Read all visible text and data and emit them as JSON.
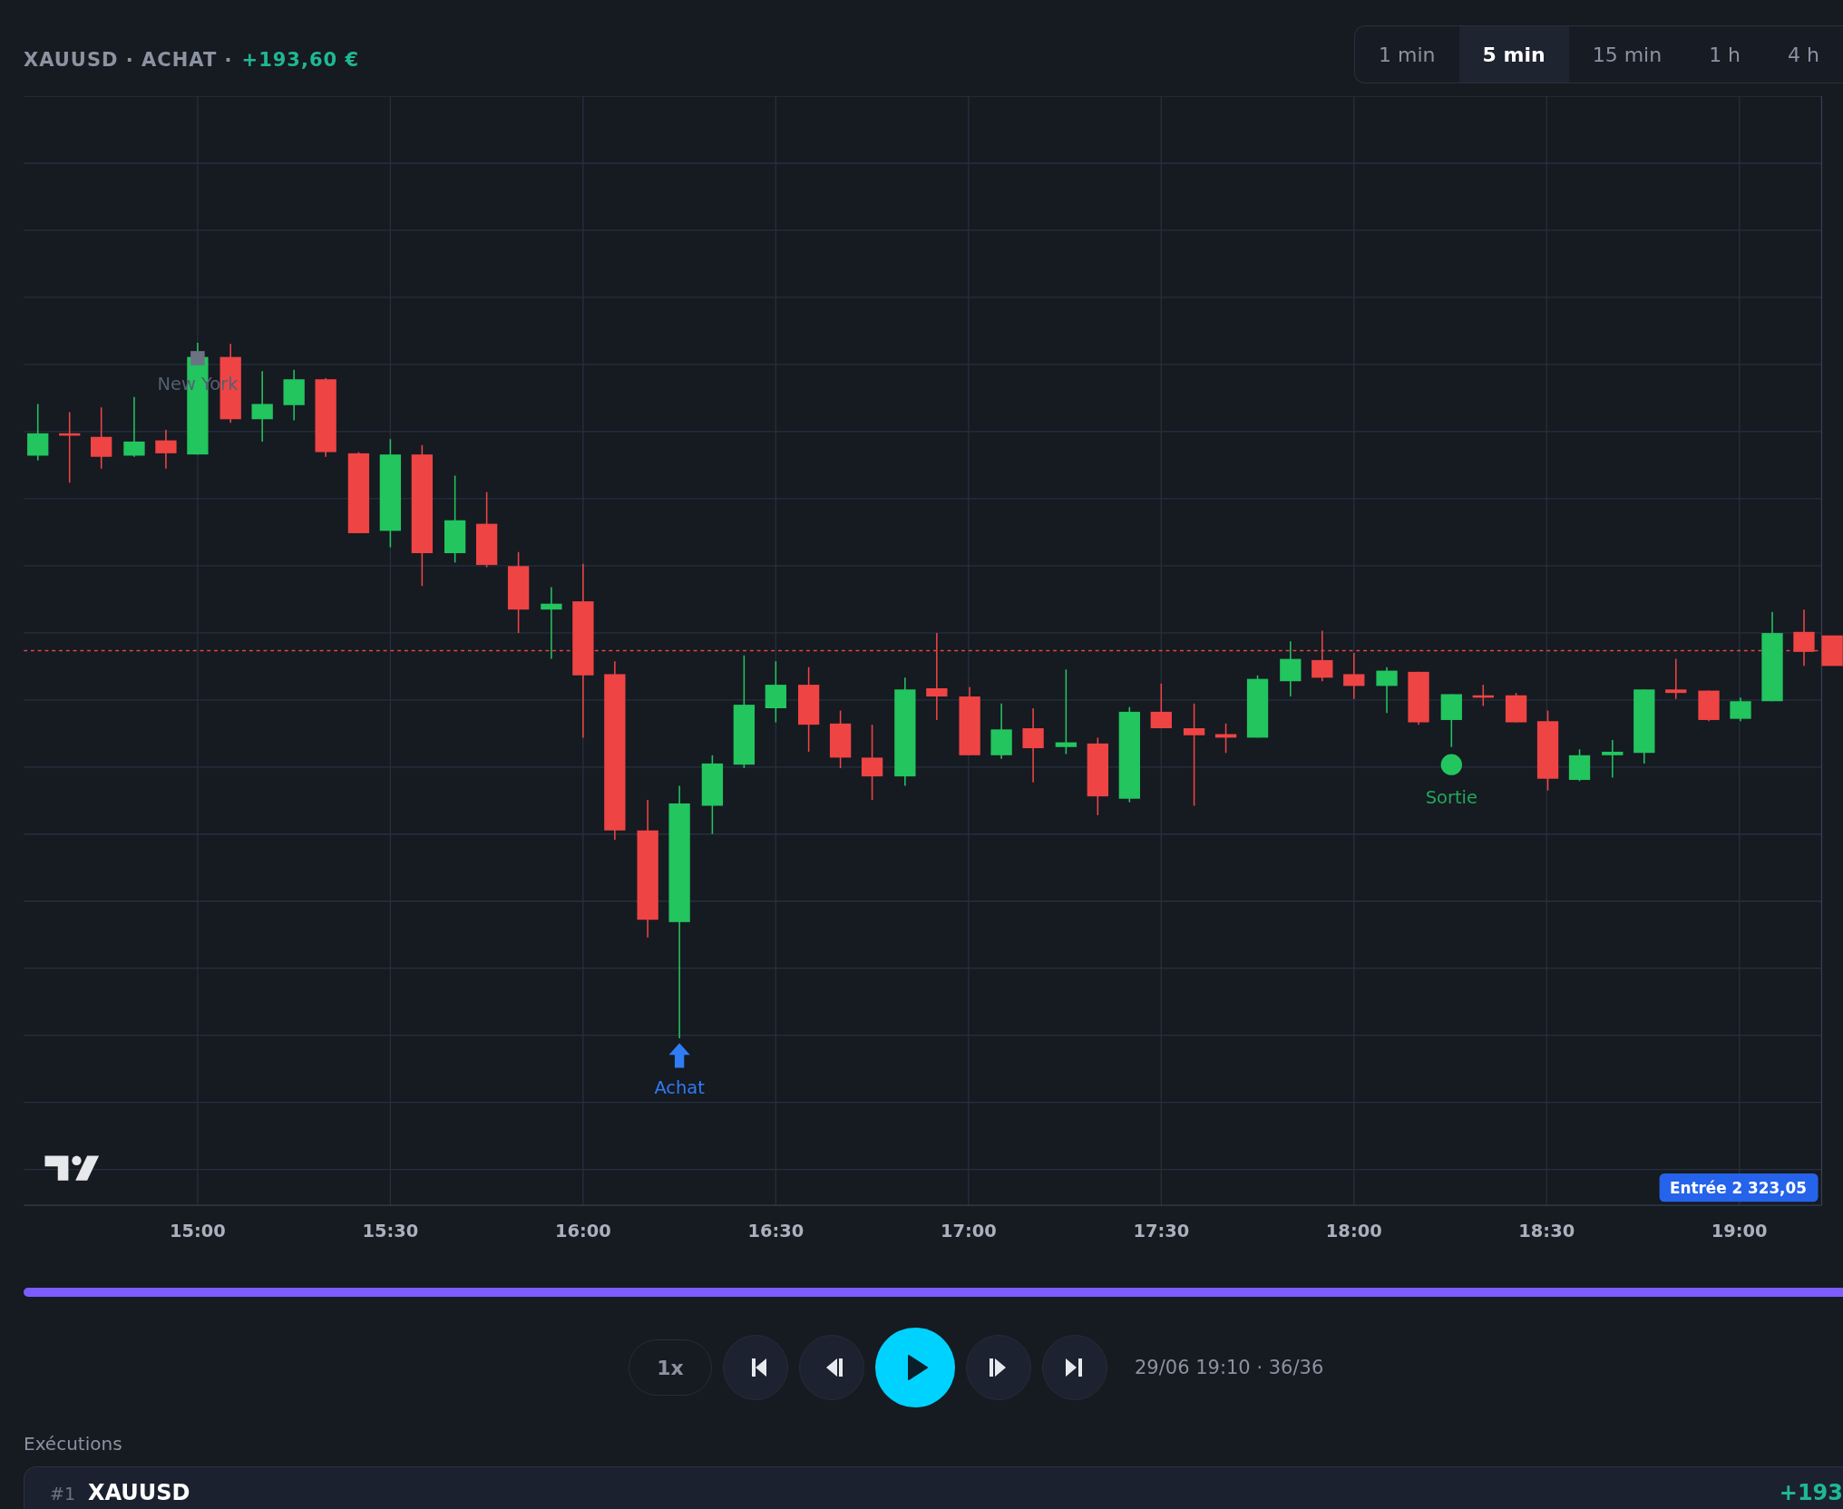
{
  "header": {
    "title": "XAUUSD · ACHAT ·",
    "pnl": "+193,60 €"
  },
  "timeframes": [
    {
      "label": "1 min",
      "selected": false
    },
    {
      "label": "5 min",
      "selected": true
    },
    {
      "label": "15 min",
      "selected": false
    },
    {
      "label": "1 h",
      "selected": false
    },
    {
      "label": "4 h",
      "selected": false
    }
  ],
  "chart": {
    "time_labels": [
      "15:00",
      "15:30",
      "16:00",
      "16:30",
      "17:00",
      "17:30",
      "18:00",
      "18:30",
      "19:00"
    ],
    "markers": [
      {
        "kind": "session",
        "label": "New York"
      },
      {
        "kind": "buy",
        "label": "Achat"
      },
      {
        "kind": "exit",
        "label": "Sortie"
      }
    ],
    "entry_label": "Entrée 2 323,05"
  },
  "replay": {
    "level": 1,
    "speed": "1x",
    "playing": false,
    "status": "29/06 19:10 · 36/36"
  },
  "executions": {
    "title": "Exécutions",
    "items": [
      {
        "index": "#1",
        "symbol": "XAUUSD",
        "pnl": "+193"
      }
    ]
  }
}
